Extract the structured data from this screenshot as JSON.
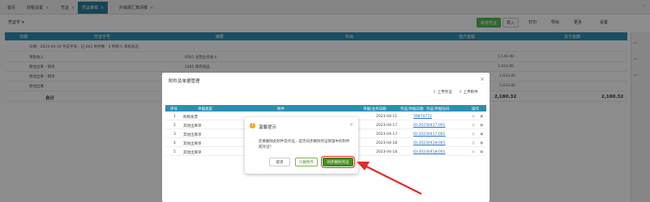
{
  "tabs": [
    {
      "label": "首页",
      "closable": false
    },
    {
      "label": "财税设置",
      "closable": true
    },
    {
      "label": "凭证",
      "closable": true
    },
    {
      "label": "凭证审核",
      "closable": true,
      "active": true
    },
    {
      "label": "外销报汇算清缴",
      "closable": true
    }
  ],
  "toolbar": {
    "add_label": "新增凭证",
    "import_label": "导入",
    "more_label": "更多",
    "print_label": "打印",
    "export_label": "导出",
    "settings_label": "设置",
    "filter_label": "凭证字"
  },
  "grid": {
    "headers": [
      "日期",
      "凭证字号",
      "摘要",
      "科目",
      "借方金额",
      "贷方金额"
    ],
    "voucher_info": "日期：2023-04-16  凭证字号：记-003  附件数：2  制单人  审核状态",
    "rows": [
      {
        "summary": "销售收入",
        "account": "6001 主营业务收入",
        "debit": "",
        "credit": "1,140.00"
      },
      {
        "summary": "暂估出库 - 销项",
        "account": "1405 库存商品",
        "debit": "",
        "credit": "1,033.85"
      },
      {
        "summary": "暂估出库 - 销项",
        "account": "6401 主营业务成本",
        "debit": "1,033.85",
        "credit": ""
      },
      {
        "summary": "暂估出库",
        "account": "2221 应交税费",
        "debit": "",
        "credit": "1,033.85"
      }
    ],
    "total_label": "合计",
    "total_debit": "2,180.32",
    "total_credit": "2,180.32"
  },
  "dialog": {
    "title": "附件及单据管理",
    "upload_label": "上传凭证",
    "upload_attachment_label": "上传附件",
    "headers": [
      "序号",
      "单据类型",
      "附件",
      "单据/业务日期",
      "凭证/单据日期",
      "凭证/单据号码",
      "操作"
    ],
    "rows": [
      {
        "index": "1",
        "type": "购销发票",
        "attachment": "",
        "biz_date": "",
        "date": "2023-04-11",
        "number": "39870772"
      },
      {
        "index": "2",
        "type": "其他出库单",
        "attachment": "",
        "biz_date": "",
        "date": "2023-04-17",
        "number": "ID-20230417-001"
      },
      {
        "index": "3",
        "type": "其他出库单",
        "attachment": "",
        "biz_date": "",
        "date": "2023-04-17",
        "number": "ID-20230417-002"
      },
      {
        "index": "4",
        "type": "其他出库单",
        "attachment": "",
        "biz_date": "",
        "date": "2023-04-18",
        "number": "ID-20230418-001"
      },
      {
        "index": "5",
        "type": "其他出库单",
        "attachment": "",
        "biz_date": "",
        "date": "2023-04-18",
        "number": "ID-20230418-001"
      }
    ]
  },
  "confirm": {
    "title": "温馨提示",
    "message": "您要删除此附件及凭证，是否同步删除凭证管理中的附件或凭证？",
    "cancel_label": "取消",
    "only_label": "只删附件",
    "both_label": "同步删除凭证"
  },
  "colors": {
    "accent": "#2a8fb2",
    "confirm_green": "#4a8f1e",
    "highlight_red": "#e02b2b"
  }
}
